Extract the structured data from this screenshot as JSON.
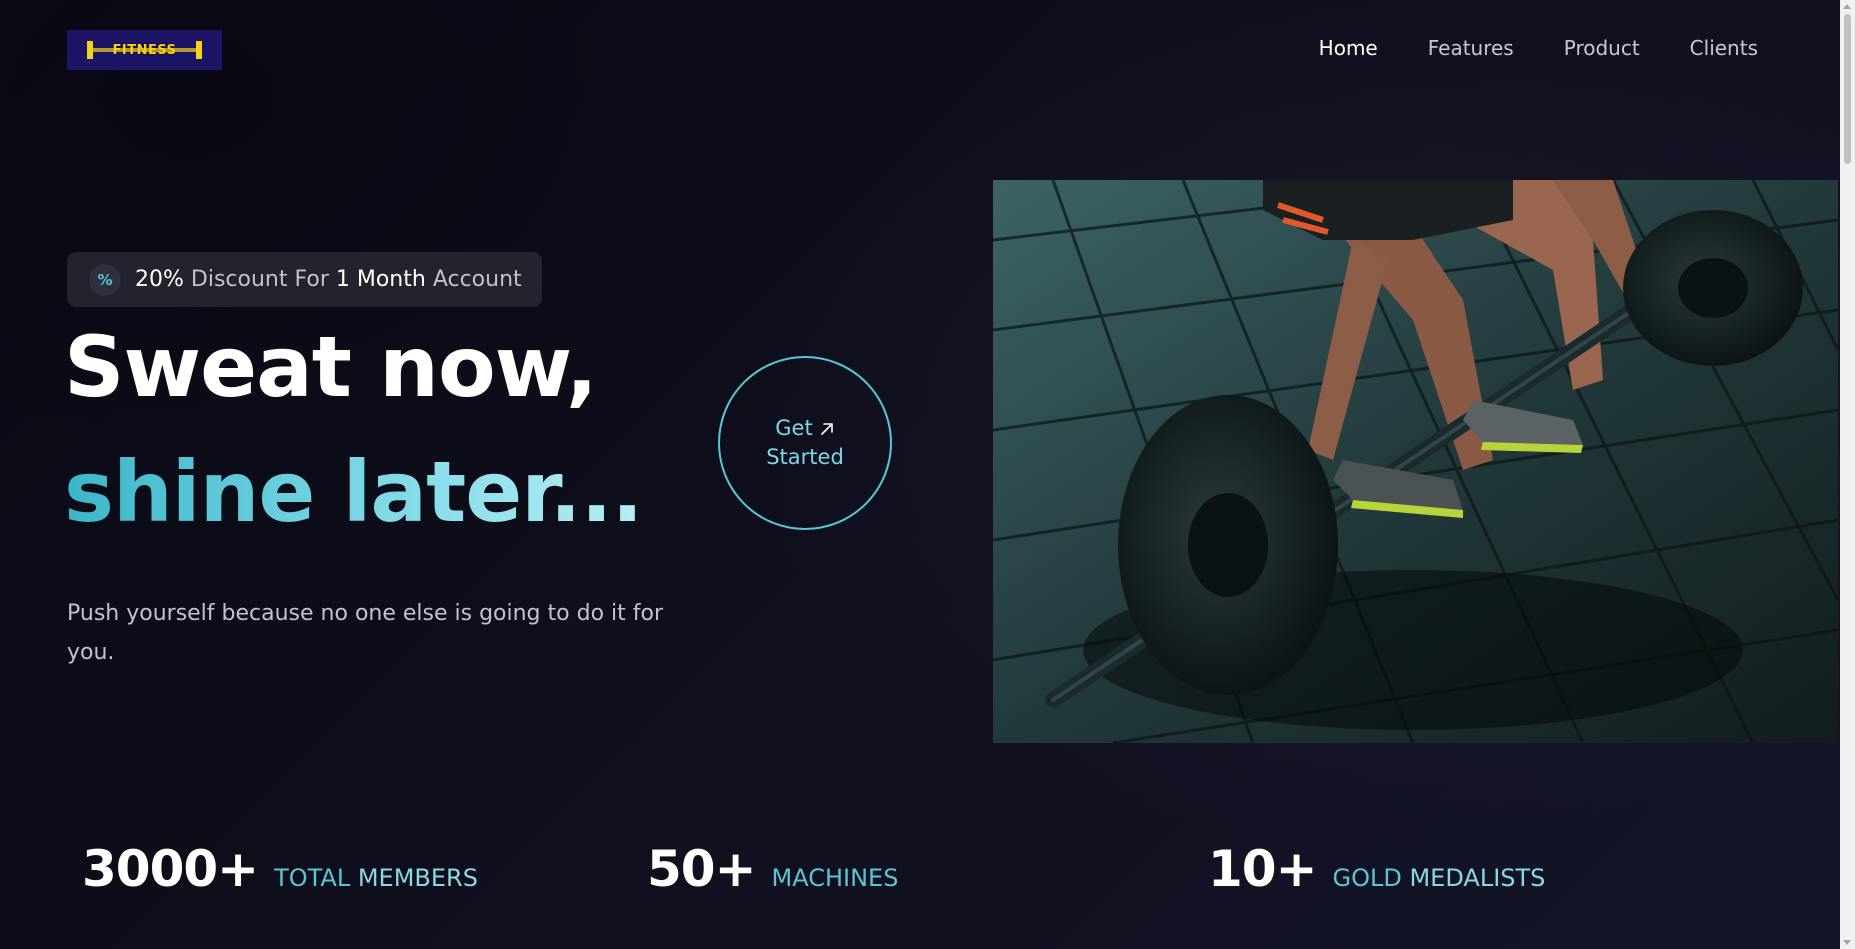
{
  "logo": {
    "text": "Fitness",
    "icon": "barbell-icon",
    "colors": {
      "background": "#1c1566",
      "accent": "#f7d21a"
    }
  },
  "nav": {
    "items": [
      {
        "label": "Home",
        "active": true
      },
      {
        "label": "Features",
        "active": false
      },
      {
        "label": "Product",
        "active": false
      },
      {
        "label": "Clients",
        "active": false
      }
    ]
  },
  "hero": {
    "badge": {
      "icon": "percent-icon",
      "percent": "20%",
      "text1": "Discount For",
      "duration": "1 Month",
      "text2": "Account"
    },
    "headline_line1": "Sweat now,",
    "headline_line2": "shine later...",
    "subtext": "Push yourself because no one else is going to do it for you.",
    "cta": {
      "line1": "Get",
      "line2": "Started",
      "icon": "arrow-up-right-icon"
    },
    "image": "barbell-deadlift-photo"
  },
  "stats": [
    {
      "number": "3000+",
      "label_a": "Total",
      "label_b": "Members"
    },
    {
      "number": "50+",
      "label_a": "Machines",
      "label_b": ""
    },
    {
      "number": "10+",
      "label_a": "Gold",
      "label_b": "Medalists"
    }
  ],
  "colors": {
    "accent": "#56c8d9",
    "background": "#0e0e1c",
    "badge_bg": "#23232d"
  }
}
